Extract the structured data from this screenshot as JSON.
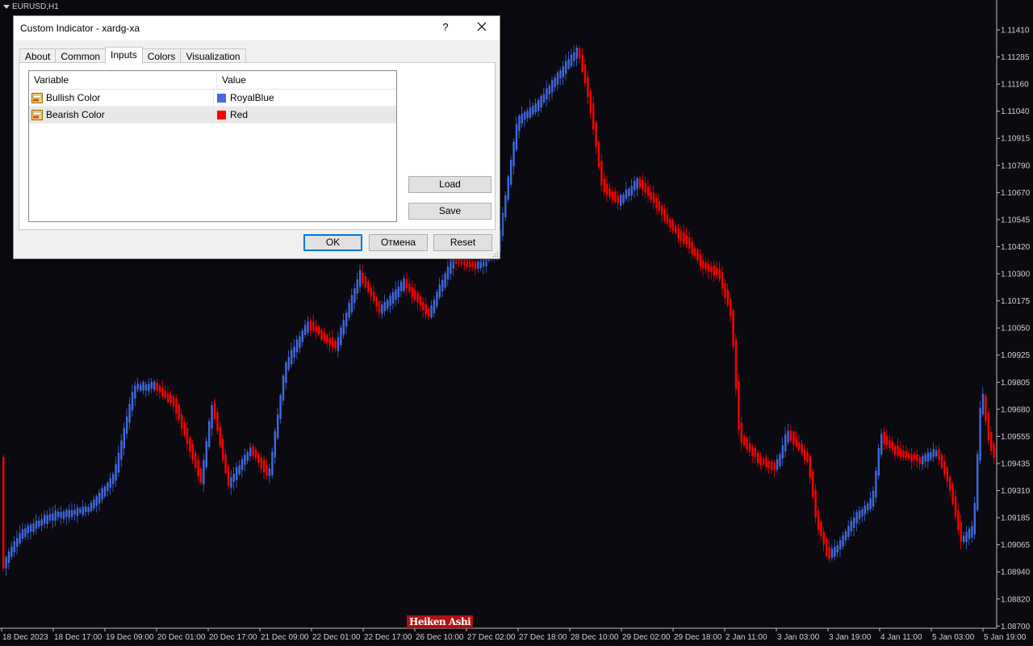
{
  "chart": {
    "symbol": "EURUSD,H1",
    "indicator_label": "Heiken Ashi",
    "price_ticks": [
      "1.11410",
      "1.11285",
      "1.11160",
      "1.11040",
      "1.10915",
      "1.10790",
      "1.10670",
      "1.10545",
      "1.10420",
      "1.10300",
      "1.10175",
      "1.10050",
      "1.09925",
      "1.09805",
      "1.09680",
      "1.09555",
      "1.09435",
      "1.09310",
      "1.09185",
      "1.09065",
      "1.08940",
      "1.08820",
      "1.08700"
    ],
    "time_ticks": [
      "18 Dec 2023",
      "18 Dec 17:00",
      "19 Dec 09:00",
      "20 Dec 01:00",
      "20 Dec 17:00",
      "21 Dec 09:00",
      "22 Dec 01:00",
      "22 Dec 17:00",
      "26 Dec 10:00",
      "27 Dec 02:00",
      "27 Dec 18:00",
      "28 Dec 10:00",
      "29 Dec 02:00",
      "29 Dec 18:00",
      "2 Jan 11:00",
      "3 Jan 03:00",
      "3 Jan 19:00",
      "4 Jan 11:00",
      "5 Jan 03:00",
      "5 Jan 19:00"
    ],
    "bull_color": "#4169e1",
    "bear_color": "#ff0000",
    "background": "#0a0a10"
  },
  "dialog": {
    "title": "Custom Indicator - xardg-xa",
    "help": "?",
    "tabs": [
      {
        "label": "About"
      },
      {
        "label": "Common"
      },
      {
        "label": "Inputs"
      },
      {
        "label": "Colors"
      },
      {
        "label": "Visualization"
      }
    ],
    "grid": {
      "col_variable": "Variable",
      "col_value": "Value",
      "rows": [
        {
          "variable": "Bullish Color",
          "value": "RoyalBlue",
          "color": "#4169e1"
        },
        {
          "variable": "Bearish Color",
          "value": "Red",
          "color": "#ff0000"
        }
      ]
    },
    "load": "Load",
    "save": "Save",
    "ok": "OK",
    "cancel": "Отмена",
    "reset": "Reset"
  }
}
